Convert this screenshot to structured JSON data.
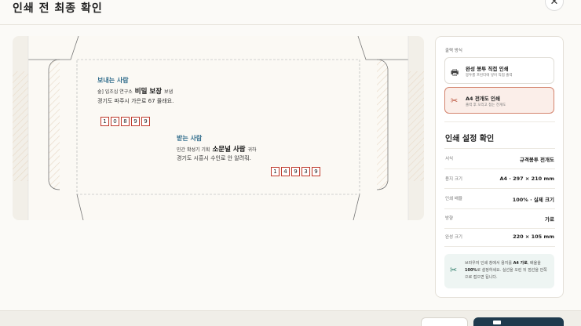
{
  "header": {
    "title": "인쇄 전 최종 확인",
    "close_icon": "close-icon"
  },
  "envelope": {
    "sender": {
      "label": "보내는 사람",
      "org": "숲] 입조심 연구소",
      "name": "비밀 보장",
      "suffix": "보냄",
      "address": "경기도 파주시 가은로 67 몰래요.",
      "zip": [
        "1",
        "0",
        "8",
        "9",
        "9"
      ]
    },
    "recipient": {
      "label": "받는 사람",
      "org": "민간 확성기 기획",
      "name": "소문널 사람",
      "suffix": "귀하",
      "address": "경기도 시흥시 수인로 안 알려줘.",
      "zip": [
        "1",
        "4",
        "9",
        "3",
        "9"
      ]
    }
  },
  "panel": {
    "output_method_label": "출력 방식",
    "options": [
      {
        "title": "완성 봉투 직접 인쇄",
        "subtitle": "봉투를 프린터에 넣어 직접 출력",
        "icon": "printer-icon",
        "selected": false
      },
      {
        "title": "A4 전개도 인쇄",
        "subtitle": "출력 후 오리고 접는 전개도",
        "icon": "scissors-icon",
        "selected": true
      }
    ],
    "confirm_title": "인쇄 설정 확인",
    "settings": [
      {
        "key": "서식",
        "value": "규격봉투 전개도"
      },
      {
        "key": "용지 크기",
        "value": "A4 · 297 × 210 mm"
      },
      {
        "key": "인쇄 배율",
        "value": "100% · 실제 크기"
      },
      {
        "key": "방향",
        "value": "가로"
      },
      {
        "key": "완성 크기",
        "value": "220 × 105 mm"
      }
    ],
    "notice": {
      "icon": "scissors-icon",
      "part1": "브라우저 인쇄 창에서 용지를 ",
      "bold1": "A4 가로",
      "part2": ", 배율을 ",
      "bold2": "100%",
      "part3": "로 설정하세요. 실선을 오린 뒤 점선을 안쪽으로 접으면 됩니다."
    }
  },
  "colors": {
    "accent": "#2e6b8a",
    "selected_border": "#d4846e",
    "zip_border": "#c0392b",
    "primary_button": "#1f3a4d"
  }
}
